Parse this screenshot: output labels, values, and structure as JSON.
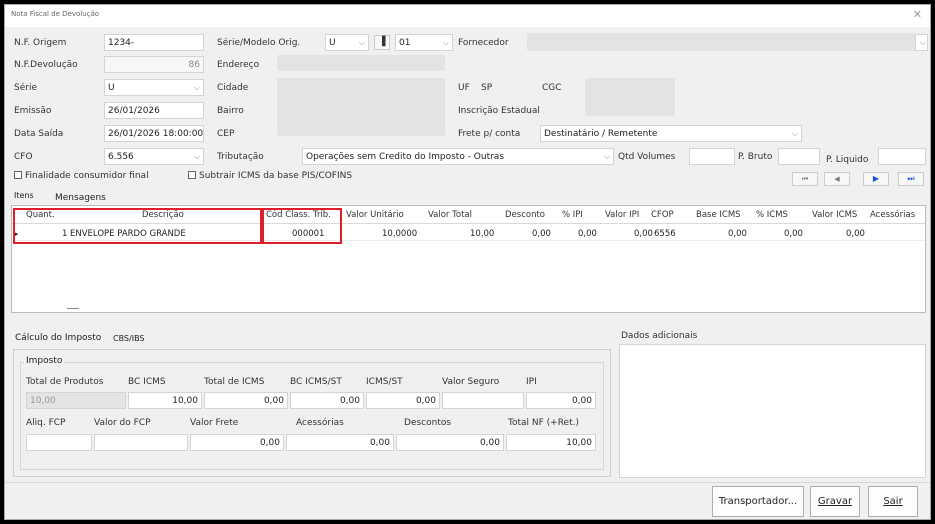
{
  "window": {
    "title": "Nota Fiscal de Devolução"
  },
  "header": {
    "nf_origem_label": "N.F. Origem",
    "nf_origem_value": "1234-",
    "serie_modelo_label": "Série/Modelo Orig.",
    "serie_orig_value": "U",
    "modelo_value": "01",
    "fornecedor_label": "Fornecedor",
    "nf_devolucao_label": "N.F.Devolução",
    "nf_devolucao_value": "86",
    "endereco_label": "Endereço",
    "serie_label": "Série",
    "serie_value": "U",
    "cidade_label": "Cidade",
    "uf_label": "UF",
    "uf_value": "SP",
    "cgc_label": "CGC",
    "emissao_label": "Emissão",
    "emissao_value": "26/01/2026",
    "bairro_label": "Bairro",
    "inscricao_label": "Inscrição Estadual",
    "data_saida_label": "Data Saída",
    "data_saida_value": "26/01/2026 18:00:00",
    "cep_label": "CEP",
    "frete_label": "Frete p/ conta",
    "frete_value": "Destinatário / Remetente",
    "cfo_label": "CFO",
    "cfo_value": "6.556",
    "tributacao_label": "Tributação",
    "tributacao_value": "Operações sem Credito do Imposto - Outras",
    "qtd_volumes_label": "Qtd Volumes",
    "p_bruto_label": "P. Bruto",
    "p_liquido_label": "P. Liquido",
    "finalidade_label": "Finalidade consumidor final",
    "subtrair_label": "Subtrair ICMS da base PIS/COFINS"
  },
  "nav": {
    "first": "⏮",
    "prev": "◀",
    "next": "▶",
    "last": "⏭"
  },
  "tabs": {
    "itens": "Itens",
    "mensagens": "Mensagens"
  },
  "grid": {
    "columns": [
      "Quant.",
      "Descrição",
      "Cód Class. Trib.",
      "Valor Unitário",
      "Valor Total",
      "Desconto",
      "% IPI",
      "Valor IPI",
      "CFOP",
      "Base ICMS",
      "% ICMS",
      "Valor ICMS",
      "Acessórias"
    ],
    "row": {
      "quant": "1",
      "descricao": "ENVELOPE PARDO GRANDE",
      "cod_class": "000001",
      "valor_unitario": "10,0000",
      "valor_total": "10,00",
      "desconto": "0,00",
      "pct_ipi": "0,00",
      "valor_ipi": "0,00",
      "cfop": "6556",
      "base_icms": "0,00",
      "pct_icms": "0,00",
      "valor_icms": "0,00"
    }
  },
  "calc": {
    "tab_calculo": "Cálculo do Imposto",
    "tab_cbs": "CBS/IBS",
    "group_title": "Imposto",
    "total_produtos_label": "Total de Produtos",
    "total_produtos_value": "10,00",
    "bc_icms_label": "BC ICMS",
    "bc_icms_value": "10,00",
    "total_icms_label": "Total de ICMS",
    "total_icms_value": "0,00",
    "bc_icms_st_label": "BC ICMS/ST",
    "bc_icms_st_value": "0,00",
    "icms_st_label": "ICMS/ST",
    "icms_st_value": "0,00",
    "valor_seguro_label": "Valor Seguro",
    "ipi_label": "IPI",
    "ipi_value": "0,00",
    "aliq_fcp_label": "Aliq. FCP",
    "valor_fcp_label": "Valor do FCP",
    "valor_frete_label": "Valor Frete",
    "valor_frete_value": "0,00",
    "acessorias_label": "Acessórias",
    "acessorias_value": "0,00",
    "descontos_label": "Descontos",
    "descontos_value": "0,00",
    "total_nf_label": "Total NF (+Ret.)",
    "total_nf_value": "10,00"
  },
  "dados": {
    "title": "Dados adicionais"
  },
  "buttons": {
    "transportador": "Transportador...",
    "gravar": "Gravar",
    "sair": "Sair"
  }
}
